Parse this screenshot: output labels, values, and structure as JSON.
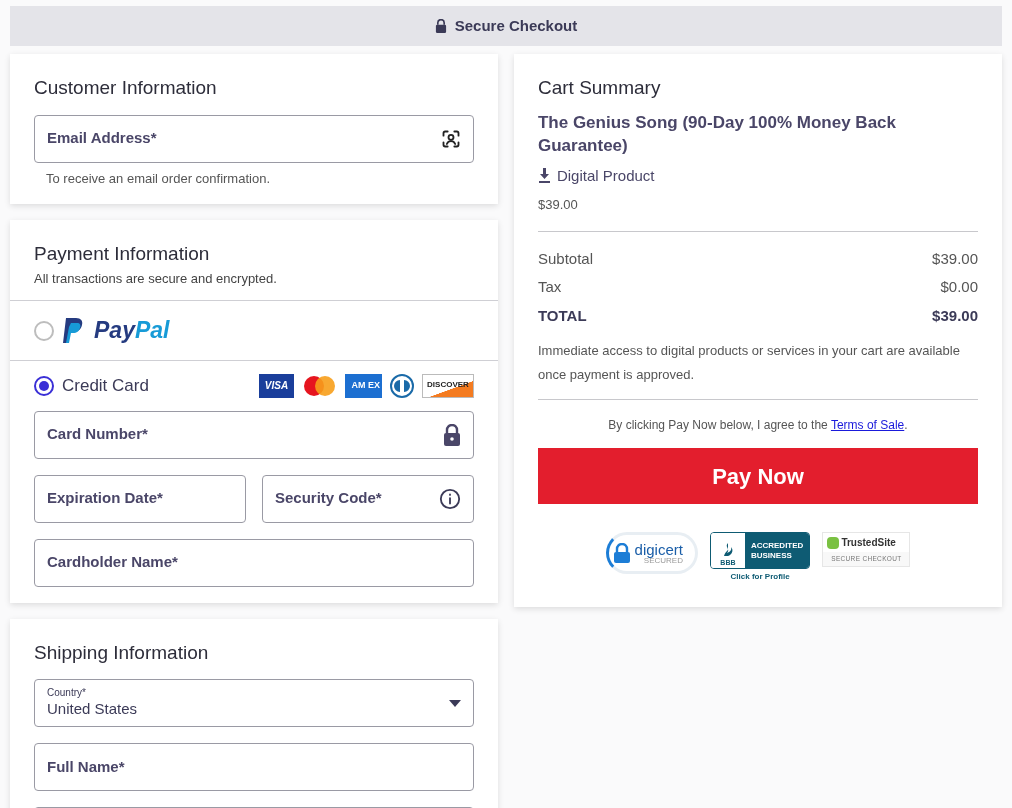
{
  "header": {
    "title": "Secure Checkout"
  },
  "customer": {
    "title": "Customer Information",
    "email": {
      "label": "Email Address*"
    },
    "hint": "To receive an email order confirmation."
  },
  "payment": {
    "title": "Payment Information",
    "subtitle": "All transactions are secure and encrypted.",
    "methods": [
      {
        "kind": "paypal",
        "label": [
          "Pay",
          "Pal"
        ],
        "selected": false
      },
      {
        "kind": "card",
        "label": "Credit Card",
        "selected": true,
        "brands": [
          {
            "kind": "visa",
            "label": "VISA"
          },
          {
            "kind": "mastercard"
          },
          {
            "kind": "amex",
            "label": "AM EX"
          },
          {
            "kind": "diners"
          },
          {
            "kind": "discover",
            "label": "DISCOVER"
          }
        ]
      }
    ],
    "fields": [
      {
        "label": "Card Number*"
      },
      {
        "label": "Expiration Date*"
      },
      {
        "label": "Security Code*"
      },
      {
        "label": "Cardholder Name*"
      }
    ]
  },
  "shipping": {
    "title": "Shipping Information",
    "country": {
      "label": "Country*",
      "value": "United States"
    },
    "fields": [
      {
        "label": "Full Name*"
      }
    ]
  },
  "cart": {
    "title": "Cart Summary",
    "product": "The Genius Song (90-Day 100% Money Back Guarantee)",
    "product_type": "Digital Product",
    "price": "$39.00",
    "rows": [
      {
        "kind": "normal",
        "label": "Subtotal",
        "value": "$39.00"
      },
      {
        "kind": "normal",
        "label": "Tax",
        "value": "$0.00"
      },
      {
        "kind": "total",
        "label": "TOTAL",
        "value": "$39.00"
      }
    ],
    "note": "Immediate access to digital products or services in your cart are available once payment is approved.",
    "agree": {
      "text": "By clicking Pay Now below, I agree to the ",
      "link": "Terms of Sale",
      "end": "."
    },
    "button": "Pay Now",
    "badges": [
      {
        "kind": "digicert",
        "texts": [
          "digicert",
          "SECURED"
        ]
      },
      {
        "kind": "bbb",
        "texts": [
          "BBB",
          "ACCREDITED",
          "BUSINESS",
          "Click for Profile"
        ]
      },
      {
        "kind": "trustedsite",
        "texts": [
          "TrustedSite",
          "SECURE CHECKOUT"
        ]
      }
    ]
  }
}
